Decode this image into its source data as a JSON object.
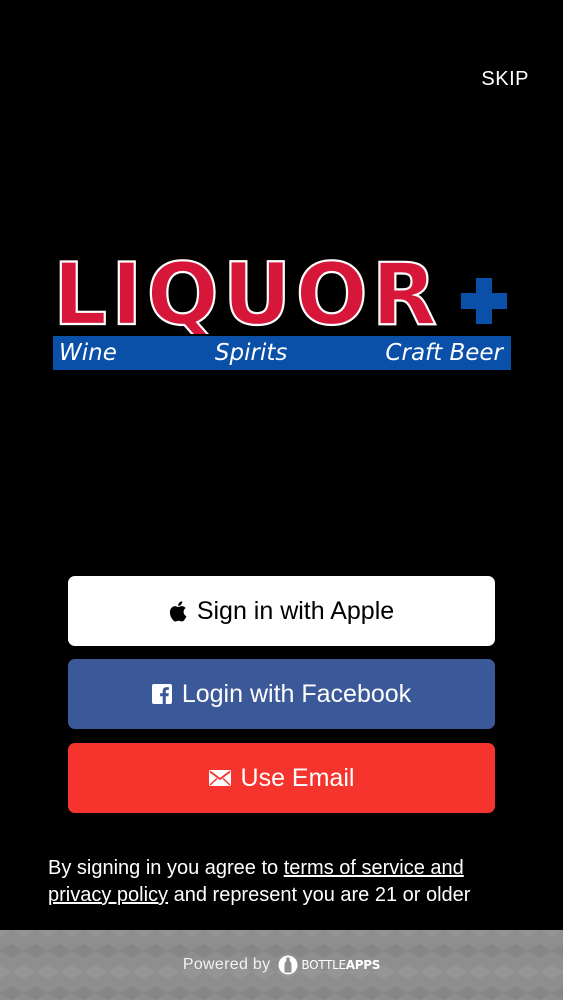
{
  "header": {
    "skip_label": "SKIP"
  },
  "logo": {
    "wordmark": "LIQUOR",
    "band": [
      "Wine",
      "Spirits",
      "Craft Beer"
    ],
    "colors": {
      "red": "#d6173a",
      "blue": "#0a4fa8"
    }
  },
  "auth": {
    "apple_label": "Sign in with Apple",
    "facebook_label": "Login with Facebook",
    "email_label": "Use Email",
    "icons": {
      "apple": "apple-icon",
      "facebook": "facebook-icon",
      "email": "envelope-icon"
    },
    "colors": {
      "apple_bg": "#ffffff",
      "facebook_bg": "#3b5998",
      "email_bg": "#f5342e"
    }
  },
  "terms": {
    "prefix": "By signing in you agree to ",
    "link": "terms of service and privacy policy",
    "suffix": " and represent you are 21 or older"
  },
  "footer": {
    "powered_by": "Powered by",
    "brand_bold": "BOTTLE",
    "brand_rest": "APPS"
  }
}
